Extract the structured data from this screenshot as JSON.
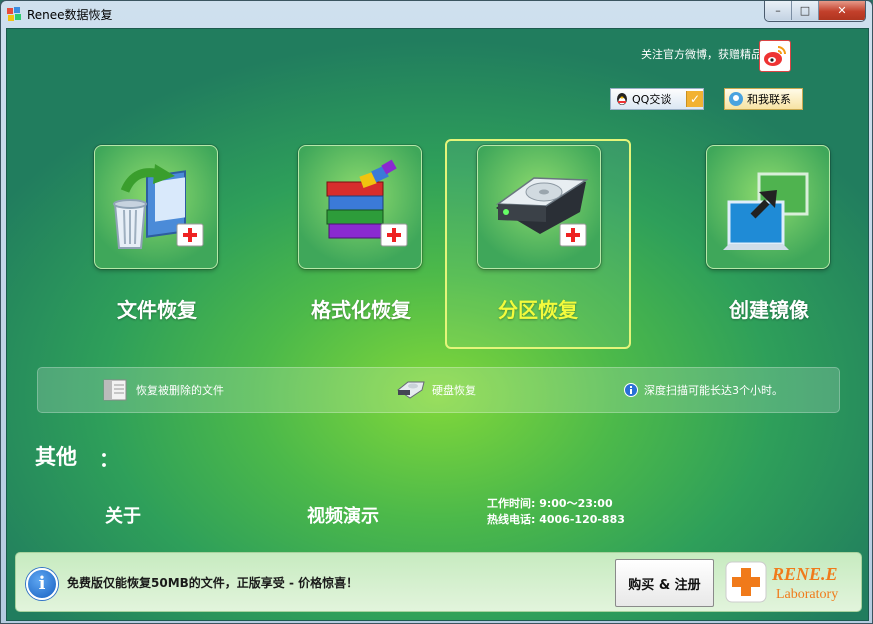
{
  "window": {
    "title": "Renee数据恢复",
    "min": "–",
    "max": "□",
    "close": "✕"
  },
  "header": {
    "weibo_text": "关注官方微博，获赠精品软件",
    "qq_label": "QQ交谈",
    "contact_label": "和我联系"
  },
  "features": [
    {
      "label": "文件恢复",
      "icon": "file-recovery-icon"
    },
    {
      "label": "格式化恢复",
      "icon": "format-recovery-icon"
    },
    {
      "label": "分区恢复",
      "icon": "partition-recovery-icon",
      "selected": true
    },
    {
      "label": "创建镜像",
      "icon": "create-image-icon"
    }
  ],
  "info_bar": {
    "item1": "恢复被删除的文件",
    "item2": "硬盘恢复",
    "item3": "深度扫描可能长达3个小时。"
  },
  "others": {
    "title": "其他",
    "colon": "：",
    "about": "关于",
    "video": "视频演示",
    "hours_line1": "工作时间: 9:00～23:00",
    "hours_line2": "热线电话: 4006-120-883"
  },
  "bottom": {
    "notice": "免费版仅能恢复50MB的文件，正版享受 - 价格惊喜！",
    "buy_label": "购买 & 注册",
    "logo_name": "RENE.E",
    "logo_sub": "Laboratory"
  },
  "colors": {
    "selected_label": "#f3fb3c",
    "accent_green": "#4cb94a"
  }
}
